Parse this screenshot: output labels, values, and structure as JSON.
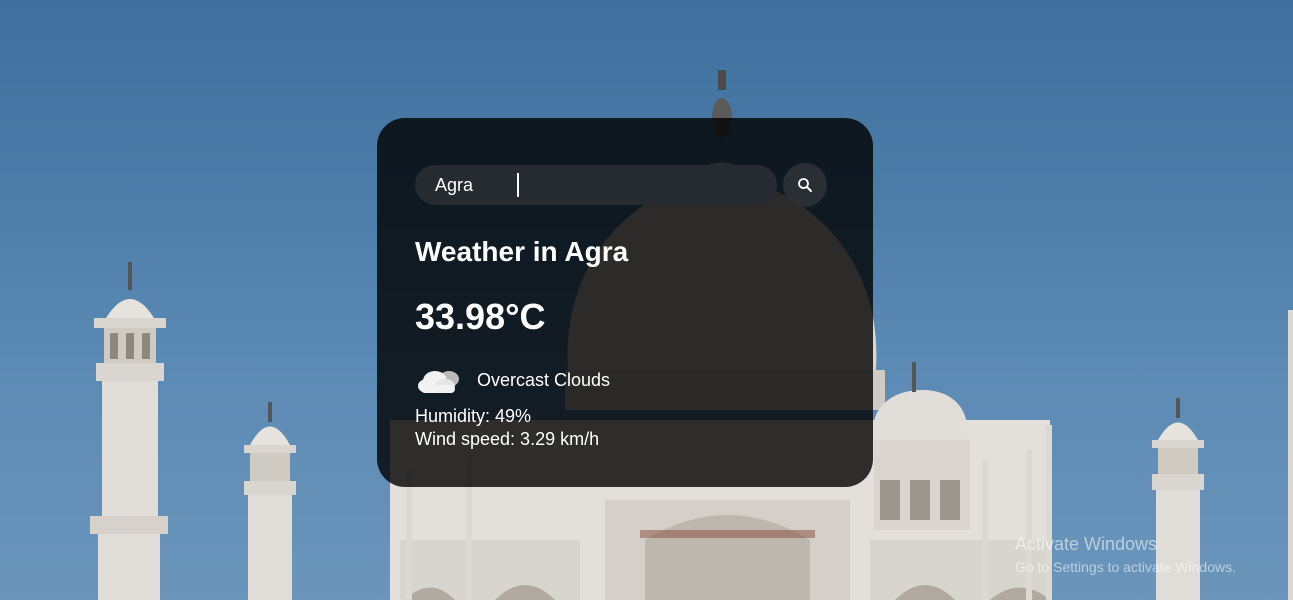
{
  "search": {
    "value": "Agra",
    "icon": "search-icon"
  },
  "weather": {
    "title": "Weather in Agra",
    "temperature": "33.98°C",
    "icon": "cloud-icon",
    "description": "Overcast Clouds",
    "humidity": "Humidity: 49%",
    "wind": "Wind speed: 3.29 km/h"
  },
  "watermark": {
    "title": "Activate Windows",
    "subtitle": "Go to Settings to activate Windows."
  },
  "background": {
    "subject": "taj-mahal-photo",
    "sky_color": "#4d7eaa"
  }
}
